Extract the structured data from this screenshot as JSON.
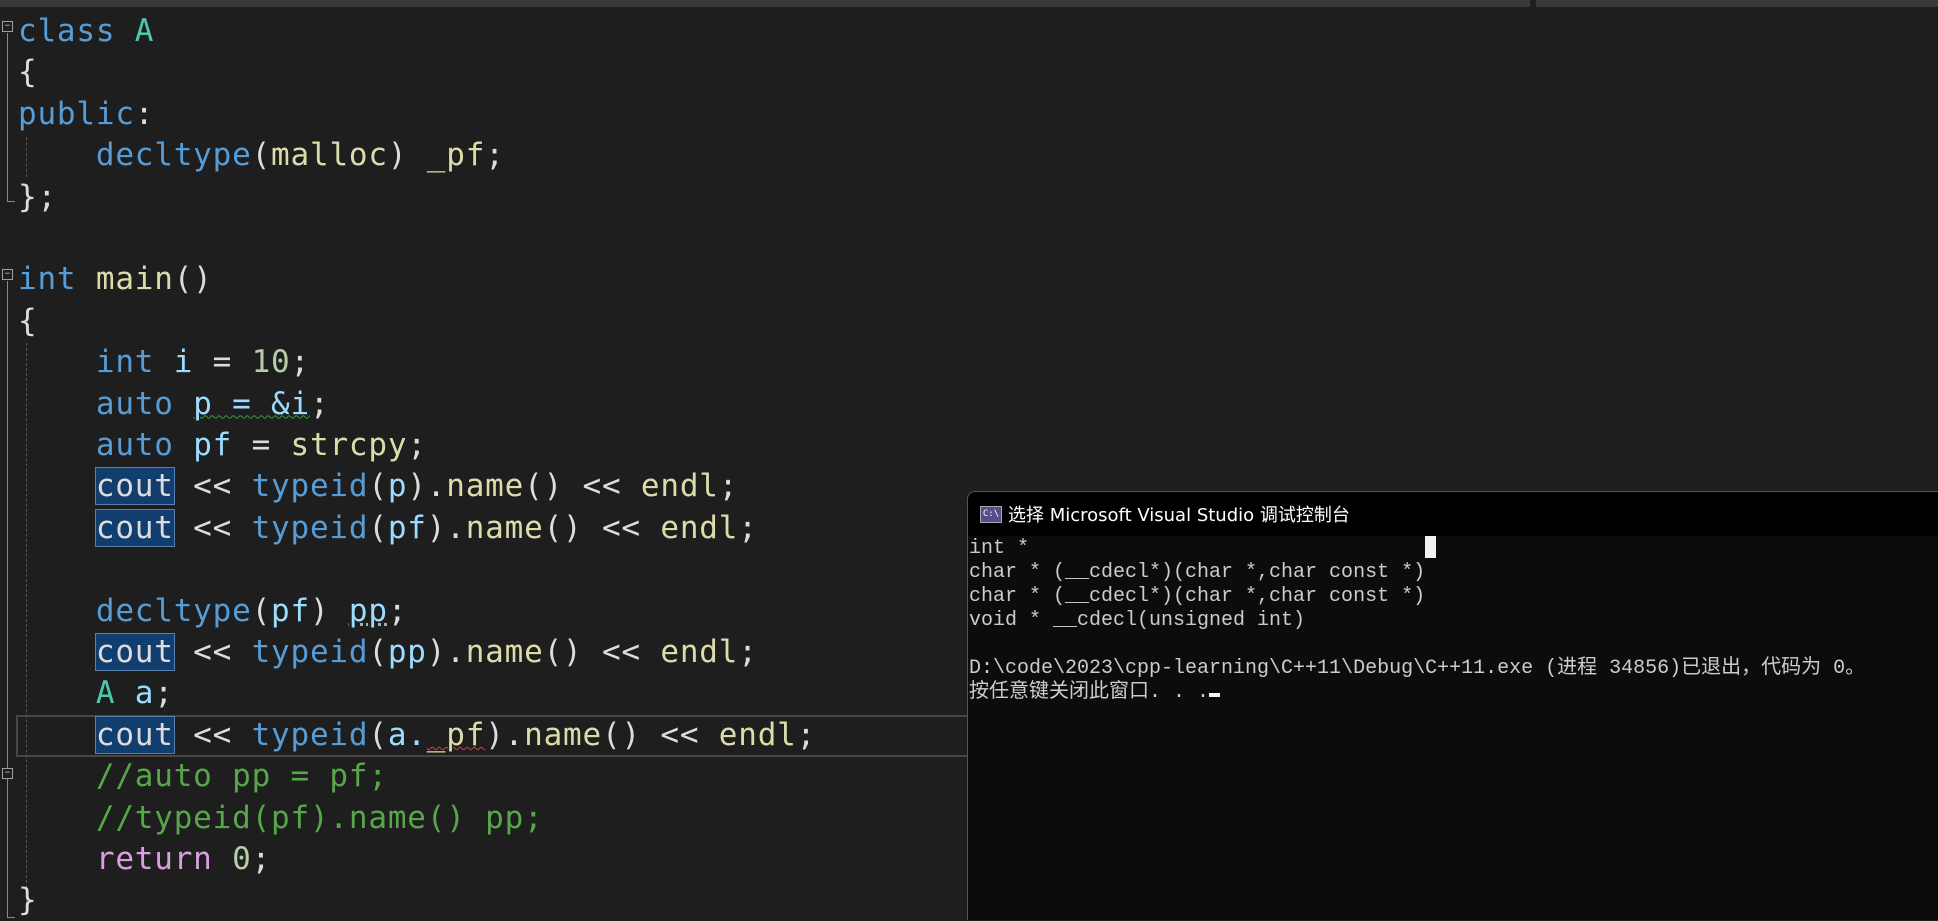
{
  "editor": {
    "lines": [
      [
        [
          "class ",
          "kw"
        ],
        [
          "A",
          "ty"
        ]
      ],
      [
        [
          "{",
          "pl"
        ]
      ],
      [
        [
          "public",
          "kw"
        ],
        [
          ":",
          "pl"
        ]
      ],
      [
        [
          "    ",
          "pl"
        ],
        [
          "decltype",
          "kw"
        ],
        [
          "(",
          "pl"
        ],
        [
          "malloc",
          "fn"
        ],
        [
          ") ",
          "pl"
        ],
        [
          "_pf",
          "fn"
        ],
        [
          ";",
          "pl"
        ]
      ],
      [
        [
          "};",
          "pl"
        ]
      ],
      [],
      [
        [
          "int ",
          "kw"
        ],
        [
          "main",
          "fn"
        ],
        [
          "()",
          "pl"
        ]
      ],
      [
        [
          "{",
          "pl"
        ]
      ],
      [
        [
          "    ",
          "pl"
        ],
        [
          "int ",
          "kw"
        ],
        [
          "i",
          "va"
        ],
        [
          " = ",
          "pl"
        ],
        [
          "10",
          "nu"
        ],
        [
          ";",
          "pl"
        ]
      ],
      [
        [
          "    ",
          "pl"
        ],
        [
          "auto ",
          "kw"
        ],
        [
          "p = &i",
          "va squig-g"
        ],
        [
          ";",
          "pl"
        ]
      ],
      [
        [
          "    ",
          "pl"
        ],
        [
          "auto ",
          "kw"
        ],
        [
          "pf",
          "va"
        ],
        [
          " = ",
          "pl"
        ],
        [
          "strcpy",
          "fn"
        ],
        [
          ";",
          "pl"
        ]
      ],
      [
        [
          "    ",
          "pl"
        ],
        [
          "cout",
          "pl hl"
        ],
        [
          " << ",
          "pl"
        ],
        [
          "typeid",
          "kw"
        ],
        [
          "(",
          "pl"
        ],
        [
          "p",
          "va"
        ],
        [
          ").",
          "pl"
        ],
        [
          "name",
          "fn"
        ],
        [
          "() << ",
          "pl"
        ],
        [
          "endl",
          "fn"
        ],
        [
          ";",
          "pl"
        ]
      ],
      [
        [
          "    ",
          "pl"
        ],
        [
          "cout",
          "pl hl"
        ],
        [
          " << ",
          "pl"
        ],
        [
          "typeid",
          "kw"
        ],
        [
          "(",
          "pl"
        ],
        [
          "pf",
          "va"
        ],
        [
          ").",
          "pl"
        ],
        [
          "name",
          "fn"
        ],
        [
          "() << ",
          "pl"
        ],
        [
          "endl",
          "fn"
        ],
        [
          ";",
          "pl"
        ]
      ],
      [],
      [
        [
          "    ",
          "pl"
        ],
        [
          "decltype",
          "kw"
        ],
        [
          "(",
          "pl"
        ],
        [
          "pf",
          "va"
        ],
        [
          ") ",
          "pl"
        ],
        [
          "pp",
          "va dot"
        ],
        [
          ";",
          "pl"
        ]
      ],
      [
        [
          "    ",
          "pl"
        ],
        [
          "cout",
          "pl hl"
        ],
        [
          " << ",
          "pl"
        ],
        [
          "typeid",
          "kw"
        ],
        [
          "(",
          "pl"
        ],
        [
          "pp",
          "va"
        ],
        [
          ").",
          "pl"
        ],
        [
          "name",
          "fn"
        ],
        [
          "() << ",
          "pl"
        ],
        [
          "endl",
          "fn"
        ],
        [
          ";",
          "pl"
        ]
      ],
      [
        [
          "    ",
          "pl"
        ],
        [
          "A ",
          "ty"
        ],
        [
          "a",
          "va"
        ],
        [
          ";",
          "pl"
        ]
      ],
      [
        [
          "    ",
          "pl"
        ],
        [
          "cout",
          "pl hl"
        ],
        [
          " << ",
          "pl"
        ],
        [
          "typeid",
          "kw"
        ],
        [
          "(",
          "pl"
        ],
        [
          "a.",
          "va"
        ],
        [
          "_pf",
          "fn squig-r"
        ],
        [
          ").",
          "pl"
        ],
        [
          "name",
          "fn"
        ],
        [
          "() << ",
          "pl"
        ],
        [
          "endl",
          "fn"
        ],
        [
          ";",
          "pl"
        ]
      ],
      [
        [
          "    ",
          "pl"
        ],
        [
          "//auto pp = pf;",
          "cm"
        ]
      ],
      [
        [
          "    ",
          "pl"
        ],
        [
          "//typeid(pf).name() pp;",
          "cm"
        ]
      ],
      [
        [
          "    ",
          "pl"
        ],
        [
          "return ",
          "rt"
        ],
        [
          "0",
          "nu"
        ],
        [
          ";",
          "pl"
        ]
      ],
      [
        [
          "}",
          "pl"
        ]
      ]
    ],
    "fold_icon": "minus"
  },
  "console": {
    "icon_label": "C:\\",
    "title": "选择 Microsoft Visual Studio 调试控制台",
    "output": [
      "int *",
      "char * (__cdecl*)(char *,char const *)",
      "char * (__cdecl*)(char *,char const *)",
      "void * __cdecl(unsigned int)",
      "",
      "D:\\code\\2023\\cpp-learning\\C++11\\Debug\\C++11.exe (进程 34856)已退出，代码为 0。",
      "按任意键关闭此窗口. . ."
    ]
  }
}
